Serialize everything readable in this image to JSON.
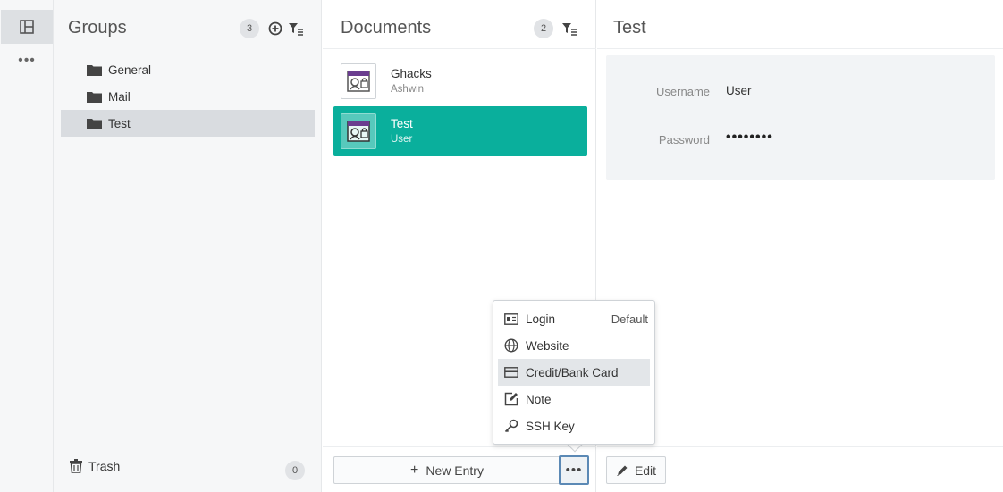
{
  "rail": {
    "more_label": "•••"
  },
  "groups": {
    "title": "Groups",
    "count": "3",
    "items": [
      {
        "label": "General"
      },
      {
        "label": "Mail"
      },
      {
        "label": "Test",
        "selected": true
      }
    ],
    "trash": {
      "label": "Trash",
      "count": "0"
    }
  },
  "documents": {
    "title": "Documents",
    "count": "2",
    "entries": [
      {
        "title": "Ghacks",
        "subtitle": "Ashwin"
      },
      {
        "title": "Test",
        "subtitle": "User",
        "selected": true
      }
    ],
    "new_entry_label": "New Entry",
    "more_label": "•••"
  },
  "detail": {
    "title": "Test",
    "fields": [
      {
        "label": "Username",
        "value": "User"
      },
      {
        "label": "Password",
        "value": "••••••••"
      }
    ],
    "edit_label": "Edit"
  },
  "new_entry_menu": {
    "items": [
      {
        "label": "Login",
        "icon": "id-card-icon",
        "default_text": "Default"
      },
      {
        "label": "Website",
        "icon": "globe-icon"
      },
      {
        "label": "Credit/Bank Card",
        "icon": "credit-card-icon",
        "highlighted": true
      },
      {
        "label": "Note",
        "icon": "note-icon"
      },
      {
        "label": "SSH Key",
        "icon": "key-icon"
      }
    ]
  },
  "colors": {
    "accent": "#0aaf9c",
    "selection": "#d9dce0",
    "focus": "#5b89b5"
  }
}
